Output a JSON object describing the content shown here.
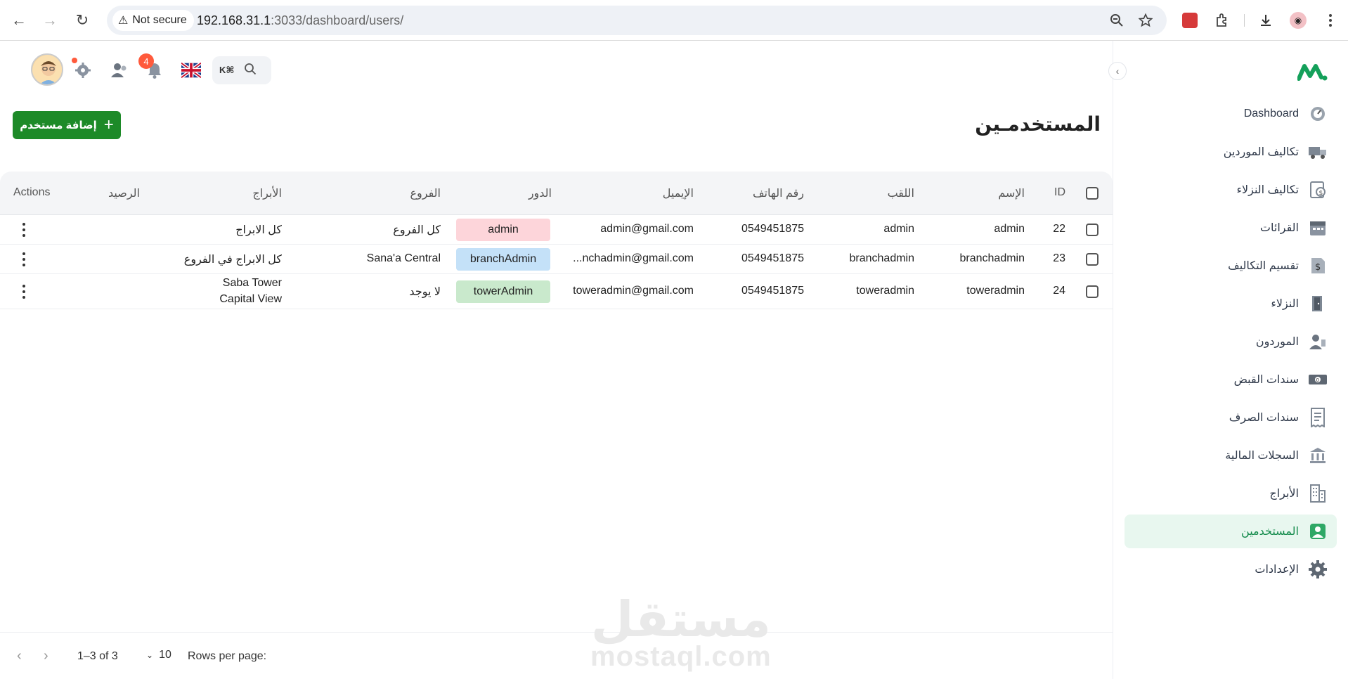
{
  "browser": {
    "security_label": "Not secure",
    "url_host": "192.168.31.1",
    "url_rest": ":3033/dashboard/users/"
  },
  "sidebar": {
    "items": [
      {
        "label": "Dashboard",
        "icon": "gauge-icon"
      },
      {
        "label": "تكاليف الموردين",
        "icon": "truck-cost-icon"
      },
      {
        "label": "تكاليف النزلاء",
        "icon": "guest-cost-icon"
      },
      {
        "label": "القرائات",
        "icon": "calendar-icon"
      },
      {
        "label": "تقسيم التكاليف",
        "icon": "dollar-split-icon"
      },
      {
        "label": "النزلاء",
        "icon": "door-icon"
      },
      {
        "label": "الموردون",
        "icon": "supplier-icon"
      },
      {
        "label": "سندات القبض",
        "icon": "banknote-icon"
      },
      {
        "label": "سندات الصرف",
        "icon": "receipt-icon"
      },
      {
        "label": "السجلات المالية",
        "icon": "bank-icon"
      },
      {
        "label": "الأبراج",
        "icon": "building-icon"
      },
      {
        "label": "المستخدمين",
        "icon": "user-icon",
        "active": true
      },
      {
        "label": "الإعدادات",
        "icon": "gear-icon"
      }
    ]
  },
  "topbar": {
    "notifications_count": "4",
    "search_shortcut": "K⌘"
  },
  "page": {
    "title": "المستخدمـين",
    "add_button_label": "إضافة مستخدم"
  },
  "table": {
    "headers": {
      "id": "ID",
      "name": "الإسم",
      "title": "اللقب",
      "phone": "رقم الهاتف",
      "email": "الإيميل",
      "role": "الدور",
      "branches": "الفروع",
      "towers": "الأبراج",
      "balance": "الرصيد",
      "actions": "Actions"
    },
    "rows": [
      {
        "id": "22",
        "name": "admin",
        "title": "admin",
        "phone": "0549451875",
        "email": "admin@gmail.com",
        "role": "admin",
        "role_color": "#fdd5da",
        "branches": "كل الفروع",
        "towers": [
          "كل الابراج"
        ],
        "balance": ""
      },
      {
        "id": "23",
        "name": "branchadmin",
        "title": "branchadmin",
        "phone": "0549451875",
        "email": "...nchadmin@gmail.com",
        "role": "branchAdmin",
        "role_color": "#c4e1f8",
        "branches": "Sana'a Central",
        "towers": [
          "كل الابراج في الفروع"
        ],
        "balance": ""
      },
      {
        "id": "24",
        "name": "toweradmin",
        "title": "toweradmin",
        "phone": "0549451875",
        "email": "toweradmin@gmail.com",
        "role": "towerAdmin",
        "role_color": "#c9e9cc",
        "branches": "لا يوجد",
        "towers": [
          "Saba Tower",
          "Capital View"
        ],
        "balance": ""
      }
    ]
  },
  "pagination": {
    "rows_per_page_label": "Rows per page:",
    "rows_per_page_value": "10",
    "range_text": "1–3 of 3"
  },
  "watermark": {
    "arabic": "مستقل",
    "latin": "mostaql.com"
  },
  "colors": {
    "accent": "#1d8a28",
    "active_nav_bg": "#e8f7ef",
    "badge": "#ff5a3c"
  }
}
